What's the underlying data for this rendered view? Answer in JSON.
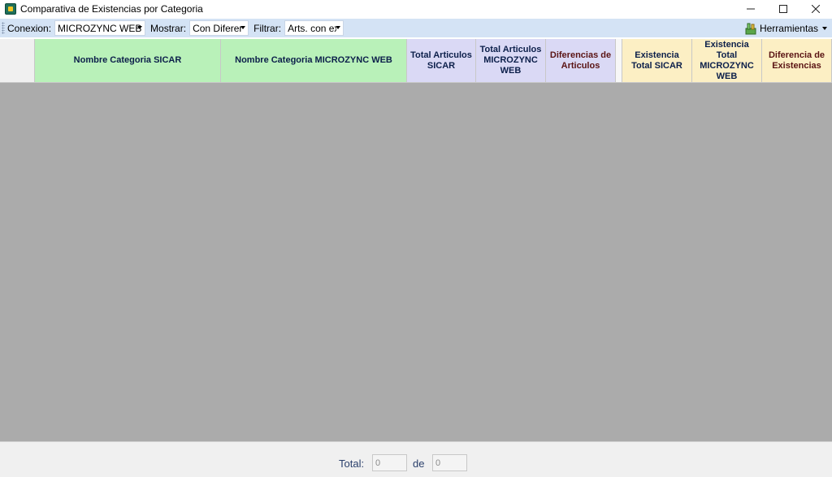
{
  "window": {
    "title": "Comparativa de Existencias por Categoria",
    "controls": {
      "minimize_icon": "minimize-icon",
      "maximize_icon": "maximize-icon",
      "close_icon": "close-icon"
    }
  },
  "toolbar": {
    "conexion_label": "Conexion:",
    "conexion_value": "MICROZYNC WEB",
    "mostrar_label": "Mostrar:",
    "mostrar_value": "Con Diferer",
    "filtrar_label": "Filtrar:",
    "filtrar_value": "Arts. con ex",
    "herramientas_label": "Herramientas"
  },
  "grid": {
    "columns": [
      {
        "key": "nombre_sicar",
        "label": "Nombre Categoria SICAR"
      },
      {
        "key": "nombre_microzync",
        "label": "Nombre Categoria MICROZYNC WEB"
      },
      {
        "key": "total_articulos_sicar",
        "label": "Total Articulos SICAR"
      },
      {
        "key": "total_articulos_microzync",
        "label": "Total Articulos MICROZYNC WEB"
      },
      {
        "key": "diferencias_articulos",
        "label": "Diferencias de Articulos"
      },
      {
        "key": "existencia_total_sicar",
        "label": "Existencia Total SICAR"
      },
      {
        "key": "existencia_total_microzync",
        "label": "Existencia Total MICROZYNC WEB"
      },
      {
        "key": "diferencia_existencias",
        "label": "Diferencia de Existencias"
      }
    ],
    "rows": []
  },
  "footer": {
    "total_label": "Total:",
    "total_value": "0",
    "de_label": "de",
    "de_value": "0"
  },
  "colors": {
    "toolbar_bg": "#d4e3f5",
    "grid_bg": "#ababab",
    "header_green": "#b9f1b9",
    "header_lavender": "#dad9f5",
    "header_yellow": "#fcefc4"
  }
}
